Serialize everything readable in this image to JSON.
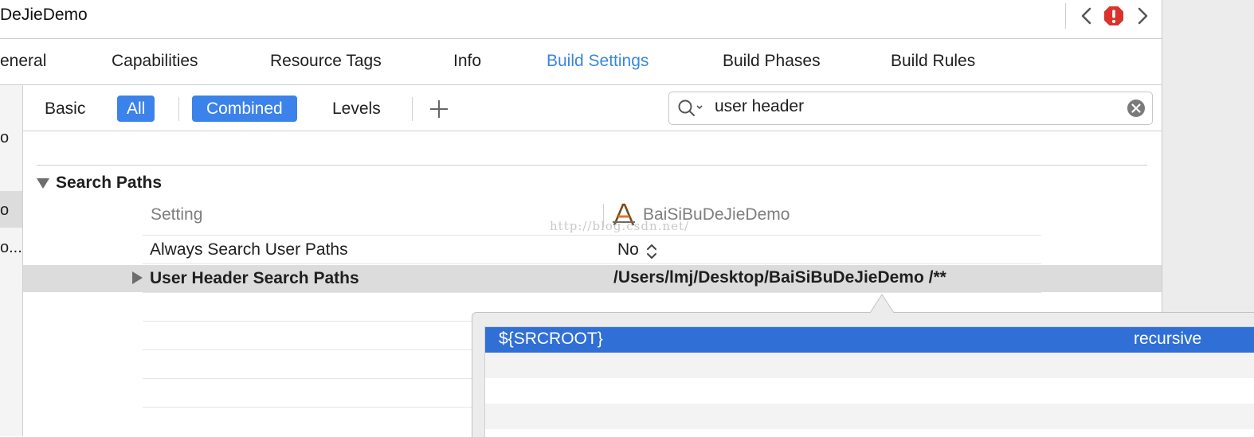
{
  "window": {
    "title": "DeJieDemo"
  },
  "tabs": [
    {
      "label": "eneral"
    },
    {
      "label": "Capabilities"
    },
    {
      "label": "Resource Tags"
    },
    {
      "label": "Info"
    },
    {
      "label": "Build Settings",
      "active": true
    },
    {
      "label": "Build Phases"
    },
    {
      "label": "Build Rules"
    }
  ],
  "sidebar": {
    "items": [
      {
        "label": "o"
      },
      {
        "label": "o",
        "selected": true
      },
      {
        "label": "o..."
      }
    ]
  },
  "filters": {
    "basic": "Basic",
    "all": "All",
    "combined": "Combined",
    "levels": "Levels"
  },
  "search": {
    "value": "user header"
  },
  "section": {
    "title": "Search Paths"
  },
  "columns": {
    "setting": "Setting",
    "target": "BaiSiBuDeJieDemo"
  },
  "rows": [
    {
      "name": "Always Search User Paths",
      "value": "No"
    },
    {
      "name": "User Header Search Paths",
      "value": "/Users/lmj/Desktop/BaiSiBuDeJieDemo  /**"
    }
  ],
  "watermark": "http://blog.csdn.net/",
  "popover": {
    "rows": [
      {
        "path": "${SRCROOT}",
        "mode": "recursive"
      }
    ]
  },
  "colors": {
    "accent": "#3a86e0",
    "selection": "#2f6fd6",
    "error": "#d9342b"
  },
  "icons": [
    "chevron-left-icon",
    "error-icon",
    "chevron-right-icon",
    "plus-icon",
    "search-icon",
    "clear-icon",
    "app-target-icon",
    "stepper-icon"
  ]
}
